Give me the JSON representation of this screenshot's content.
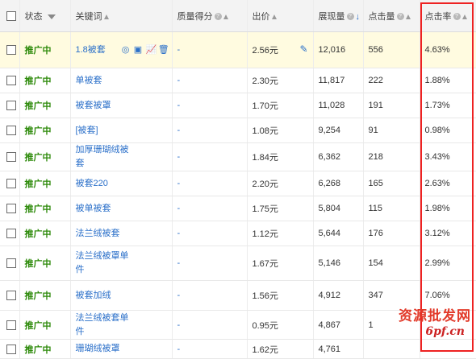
{
  "header": {
    "status": "状态",
    "keyword": "关键词",
    "quality": "质量得分",
    "bid": "出价",
    "impressions": "展现量",
    "clicks": "点击量",
    "ctr": "点击率"
  },
  "rows": [
    {
      "status": "推广中",
      "keyword": "1.8被套",
      "quality": "-",
      "bid": "2.56元",
      "impressions": "12,016",
      "clicks": "556",
      "ctr": "4.63%"
    },
    {
      "status": "推广中",
      "keyword": "单被套",
      "quality": "-",
      "bid": "2.30元",
      "impressions": "11,817",
      "clicks": "222",
      "ctr": "1.88%"
    },
    {
      "status": "推广中",
      "keyword": "被套被罩",
      "quality": "-",
      "bid": "1.70元",
      "impressions": "11,028",
      "clicks": "191",
      "ctr": "1.73%"
    },
    {
      "status": "推广中",
      "keyword": "[被套]",
      "quality": "-",
      "bid": "1.08元",
      "impressions": "9,254",
      "clicks": "91",
      "ctr": "0.98%"
    },
    {
      "status": "推广中",
      "keyword": "加厚珊瑚绒被套",
      "quality": "-",
      "bid": "1.84元",
      "impressions": "6,362",
      "clicks": "218",
      "ctr": "3.43%"
    },
    {
      "status": "推广中",
      "keyword": "被套220",
      "quality": "-",
      "bid": "2.20元",
      "impressions": "6,268",
      "clicks": "165",
      "ctr": "2.63%"
    },
    {
      "status": "推广中",
      "keyword": "被单被套",
      "quality": "-",
      "bid": "1.75元",
      "impressions": "5,804",
      "clicks": "115",
      "ctr": "1.98%"
    },
    {
      "status": "推广中",
      "keyword": "法兰绒被套",
      "quality": "-",
      "bid": "1.12元",
      "impressions": "5,644",
      "clicks": "176",
      "ctr": "3.12%"
    },
    {
      "status": "推广中",
      "keyword": "法兰绒被罩单件",
      "quality": "-",
      "bid": "1.67元",
      "impressions": "5,146",
      "clicks": "154",
      "ctr": "2.99%"
    },
    {
      "status": "推广中",
      "keyword": "被套加绒",
      "quality": "-",
      "bid": "1.56元",
      "impressions": "4,912",
      "clicks": "347",
      "ctr": "7.06%"
    },
    {
      "status": "推广中",
      "keyword": "法兰绒被套单件",
      "quality": "-",
      "bid": "0.95元",
      "impressions": "4,867",
      "clicks": "1",
      "ctr": ""
    },
    {
      "status": "推广中",
      "keyword": "珊瑚绒被罩",
      "quality": "-",
      "bid": "1.62元",
      "impressions": "4,761",
      "clicks": "",
      "ctr": ""
    }
  ],
  "watermark": {
    "line1": "资源批发网",
    "line2": "6pf.cn"
  },
  "colors": {
    "status": "#2d8a0a",
    "link": "#2a6fc9",
    "highlight_row": "#fffbe0",
    "red_box": "#e22222"
  },
  "row_icons": [
    "target-icon",
    "copy-icon",
    "trend-chart-icon",
    "trash-icon"
  ]
}
